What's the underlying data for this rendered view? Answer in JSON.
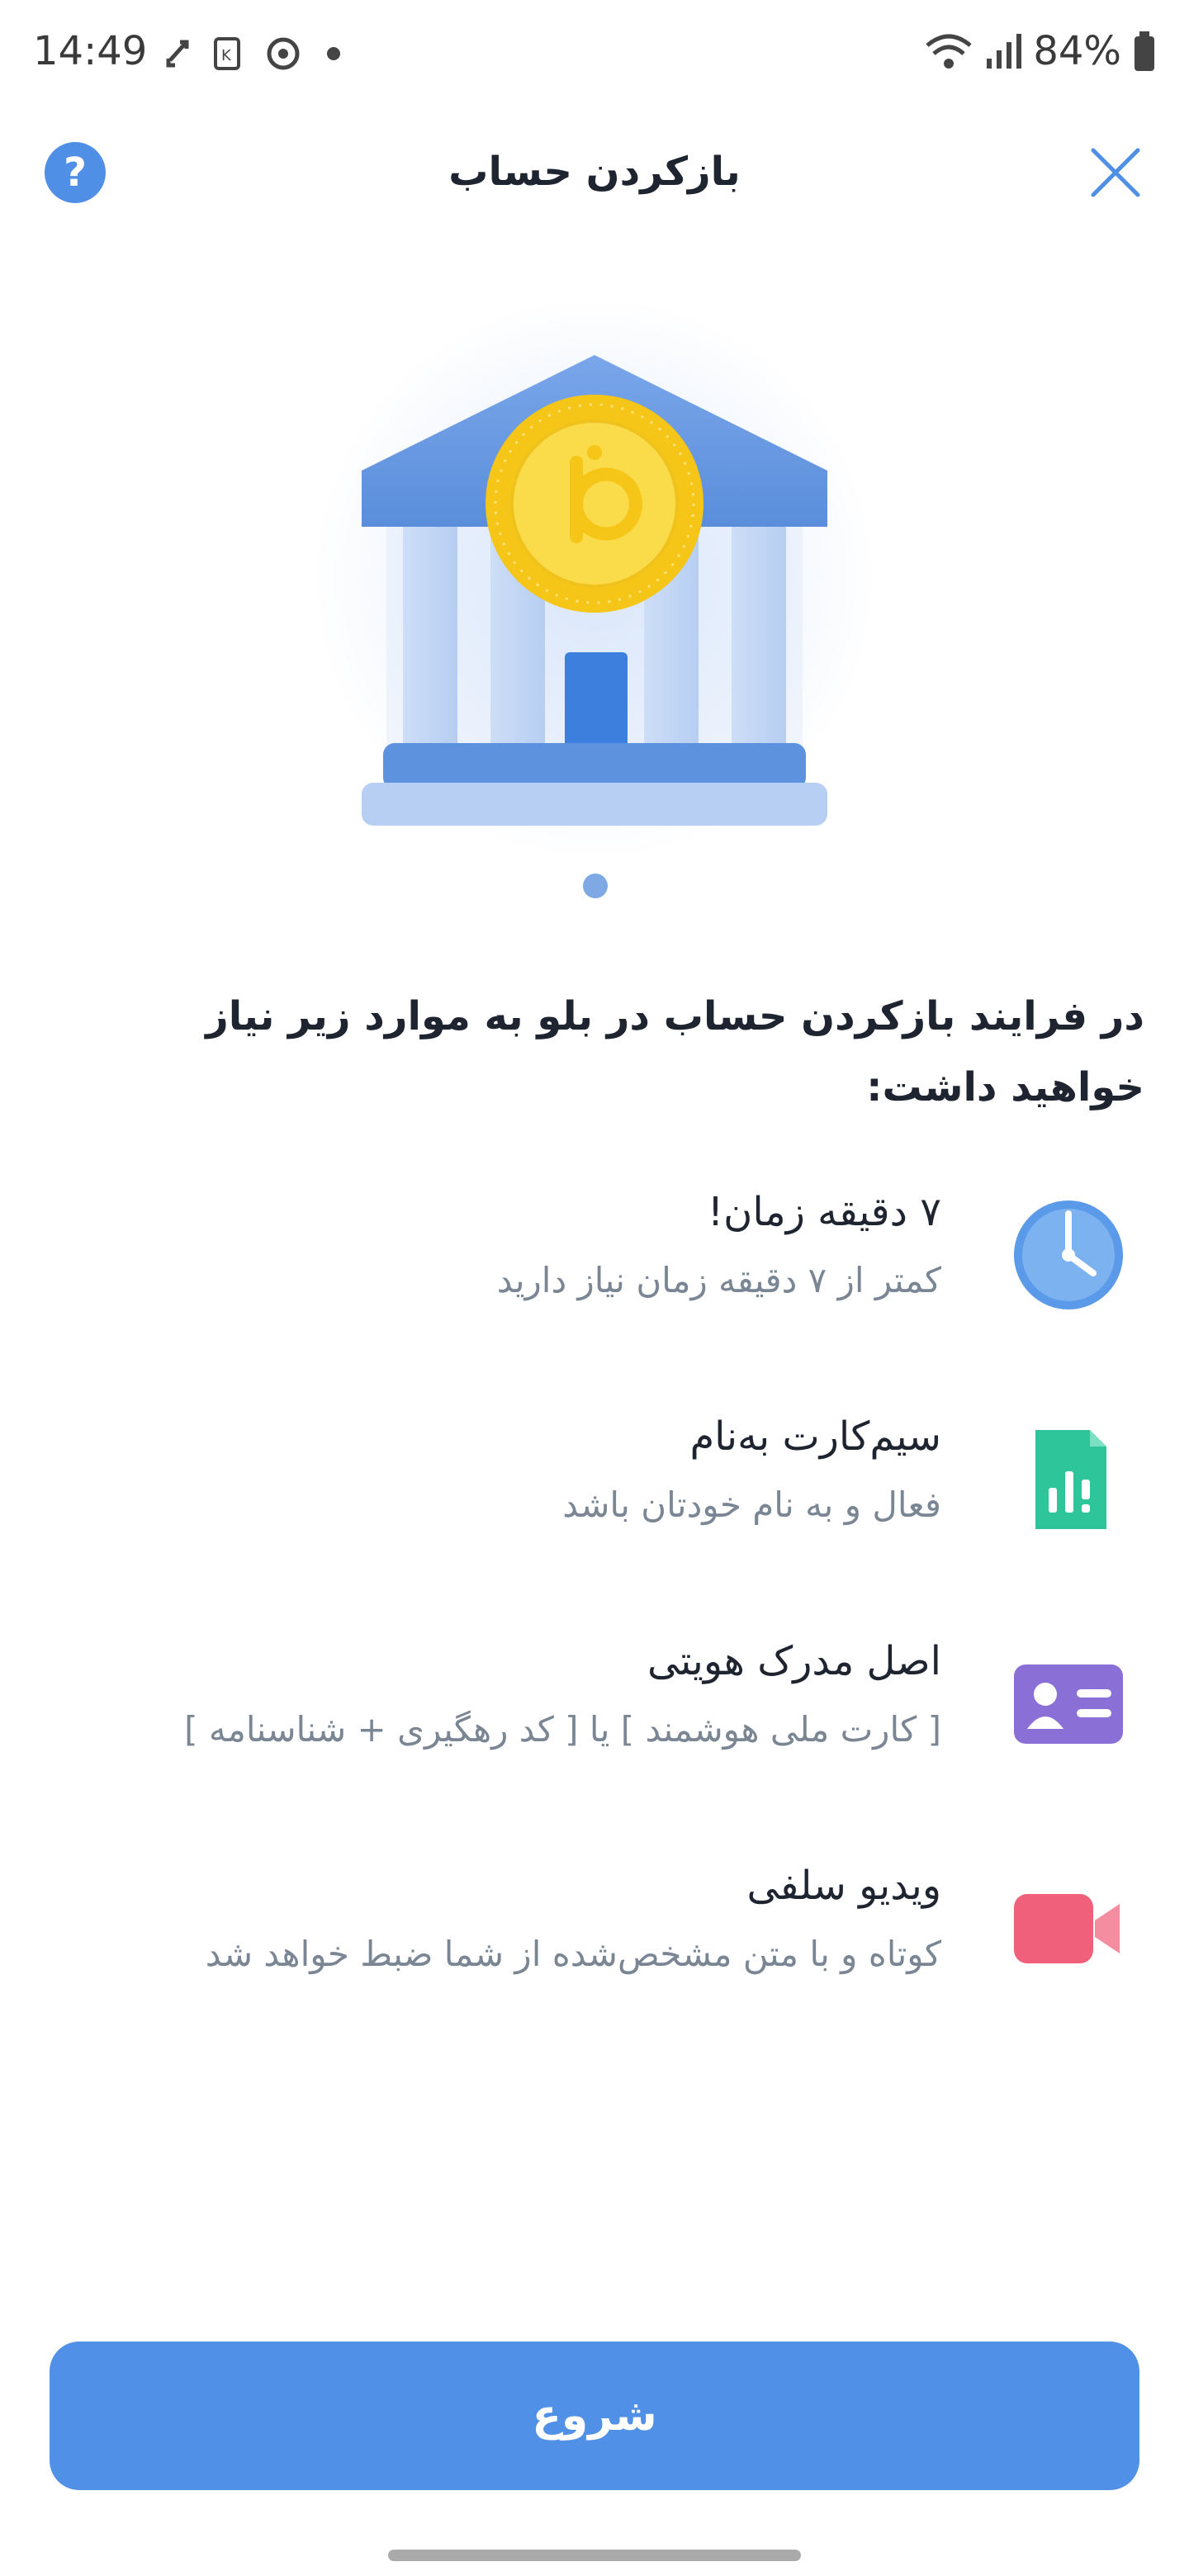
{
  "status_bar": {
    "time": "14:49",
    "battery": "84%"
  },
  "header": {
    "title": "بازکردن حساب",
    "help_label": "?"
  },
  "intro": {
    "text": "در فرایند بازکردن حساب در بلو به موارد زیر نیاز خواهید داشت:"
  },
  "requirements": [
    {
      "icon": "clock-icon",
      "title": "۷ دقیقه زمان!",
      "subtitle": "کمتر از ۷ دقیقه زمان نیاز دارید"
    },
    {
      "icon": "sim-card-icon",
      "title": "سیم‌کارت به‌نام",
      "subtitle": "فعال و به نام خودتان باشد"
    },
    {
      "icon": "id-card-icon",
      "title": "اصل مدرک هویتی",
      "subtitle": "[ کارت ملی هوشمند ] یا [ کد رهگیری + شناسنامه ]"
    },
    {
      "icon": "video-camera-icon",
      "title": "ویدیو سلفی",
      "subtitle": "کوتاه و با متن مشخص‌شده از شما ضبط خواهد شد"
    }
  ],
  "start_button": {
    "label": "شروع"
  },
  "colors": {
    "accent": "#5090e6",
    "icon_clock": "#5a9ae8",
    "icon_sim": "#2fc59a",
    "icon_id": "#8a6fd6",
    "icon_video": "#f0607a",
    "coin": "#f5c518"
  }
}
